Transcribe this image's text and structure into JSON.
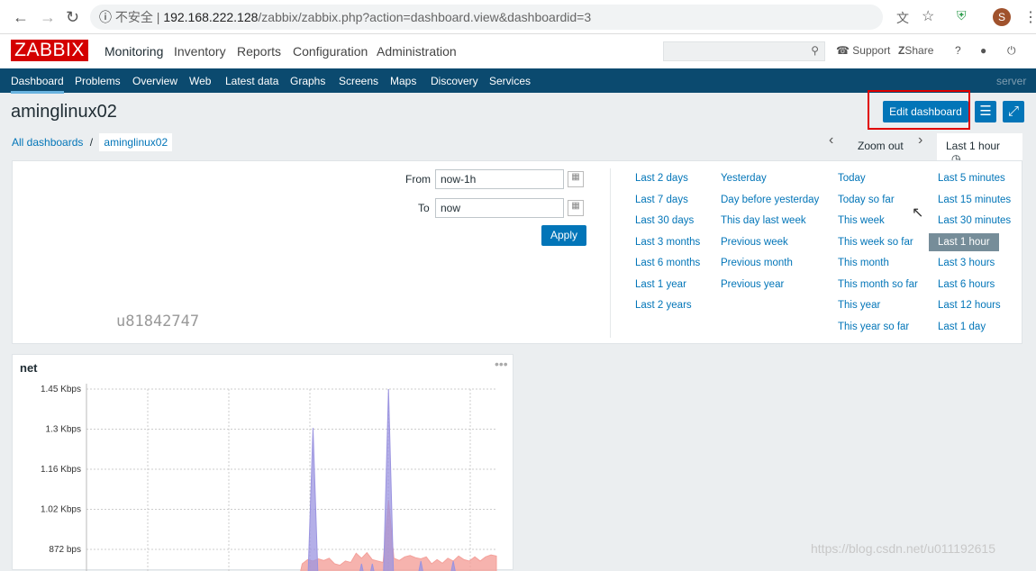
{
  "browser": {
    "insecure_label": "不安全",
    "url_host": "192.168.222.128",
    "url_path": "/zabbix/zabbix.php?action=dashboard.view&dashboardid=3",
    "profile_initial": "S"
  },
  "header": {
    "logo": "ZABBIX",
    "menu": [
      "Monitoring",
      "Inventory",
      "Reports",
      "Configuration",
      "Administration"
    ],
    "search_placeholder": "",
    "support": "Support",
    "share": "Share",
    "help": "?"
  },
  "subnav": {
    "items": [
      "Dashboard",
      "Problems",
      "Overview",
      "Web",
      "Latest data",
      "Graphs",
      "Screens",
      "Maps",
      "Discovery",
      "Services"
    ],
    "active": "Dashboard",
    "server": "server"
  },
  "page": {
    "title": "aminglinux02",
    "edit_button": "Edit dashboard"
  },
  "breadcrumb": {
    "all": "All dashboards",
    "separator": "/",
    "current": "aminglinux02"
  },
  "timenav": {
    "zoom_out": "Zoom out",
    "active_tab": "Last 1 hour"
  },
  "filter": {
    "from_label": "From",
    "from_value": "now-1h",
    "to_label": "To",
    "to_value": "now",
    "apply": "Apply",
    "columns": [
      [
        "Last 2 days",
        "Last 7 days",
        "Last 30 days",
        "Last 3 months",
        "Last 6 months",
        "Last 1 year",
        "Last 2 years"
      ],
      [
        "Yesterday",
        "Day before yesterday",
        "This day last week",
        "Previous week",
        "Previous month",
        "Previous year"
      ],
      [
        "Today",
        "Today so far",
        "This week",
        "This week so far",
        "This month",
        "This month so far",
        "This year",
        "This year so far"
      ],
      [
        "Last 5 minutes",
        "Last 15 minutes",
        "Last 30 minutes",
        "Last 1 hour",
        "Last 3 hours",
        "Last 6 hours",
        "Last 12 hours",
        "Last 1 day"
      ]
    ],
    "selected": "Last 1 hour"
  },
  "watermark_user": "u81842747",
  "widget": {
    "title": "net",
    "menu": "•••"
  },
  "chart_data": {
    "type": "area",
    "yticks": [
      "1.45 Kbps",
      "1.3 Kbps",
      "1.16 Kbps",
      "1.02 Kbps",
      "872 bps"
    ],
    "series": [
      {
        "color": "#f4a09a",
        "values": [
          0,
          0,
          0,
          0,
          0,
          0,
          0,
          0,
          0,
          0,
          0,
          0,
          0,
          0,
          0,
          0,
          0,
          0,
          0,
          0,
          0,
          0,
          0,
          0,
          0,
          0,
          0,
          0,
          0,
          0,
          0,
          0,
          0,
          0,
          0,
          0,
          0,
          0,
          0,
          0,
          820,
          835,
          830,
          838,
          832,
          840,
          820,
          815,
          830,
          825,
          858,
          840,
          860,
          835,
          830,
          825,
          1050,
          840,
          832,
          845,
          850,
          842,
          838,
          845,
          820,
          835,
          822,
          840,
          830,
          848,
          835,
          830,
          845,
          830,
          845,
          852,
          848
        ]
      },
      {
        "color": "#9b94e0",
        "values": [
          0,
          0,
          0,
          0,
          0,
          0,
          0,
          0,
          0,
          0,
          0,
          0,
          0,
          0,
          0,
          0,
          0,
          0,
          0,
          0,
          0,
          0,
          0,
          0,
          0,
          0,
          0,
          0,
          0,
          0,
          0,
          0,
          0,
          0,
          0,
          0,
          0,
          0,
          0,
          0,
          0,
          0,
          1310,
          0,
          0,
          0,
          0,
          0,
          0,
          0,
          0,
          820,
          0,
          820,
          0,
          0,
          1450,
          0,
          0,
          0,
          0,
          0,
          830,
          0,
          0,
          0,
          0,
          0,
          830,
          0,
          0,
          0,
          0,
          0,
          0,
          0,
          0
        ]
      }
    ]
  },
  "watermark_blog": "https://blog.csdn.net/u011192615"
}
